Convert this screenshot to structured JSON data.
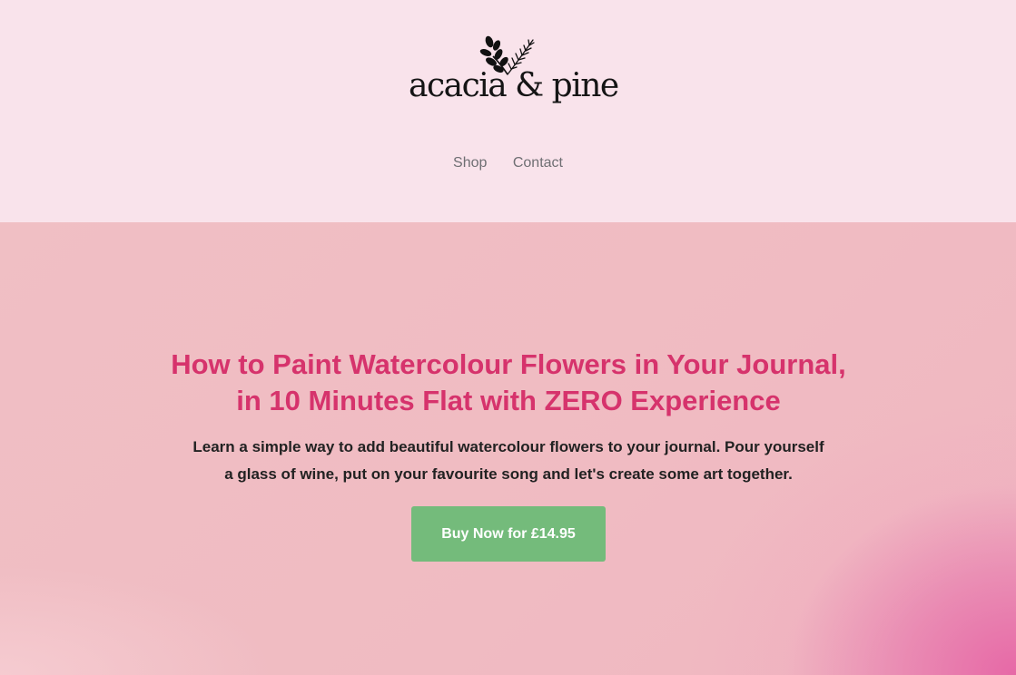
{
  "brand": {
    "name": "acacia & pine",
    "logo_icon": "leaf-sprig-icon"
  },
  "nav": {
    "items": [
      {
        "label": "Shop"
      },
      {
        "label": "Contact"
      }
    ]
  },
  "hero": {
    "headline_line1": "How to Paint Watercolour Flowers in Your Journal,",
    "headline_line2": "in 10 Minutes Flat with ZERO Experience",
    "subtext_line1": "Learn a simple way to add beautiful watercolour flowers to your journal. Pour yourself",
    "subtext_line2": "a glass of wine, put on your favourite song and let's create some art together.",
    "cta_label": "Buy Now for £14.95"
  },
  "colors": {
    "header_bg": "#f9e3eb",
    "hero_bg": "#f0bcc2",
    "headline": "#d6336c",
    "cta_bg": "#74bb7b",
    "nav_text": "#6f6f73"
  }
}
